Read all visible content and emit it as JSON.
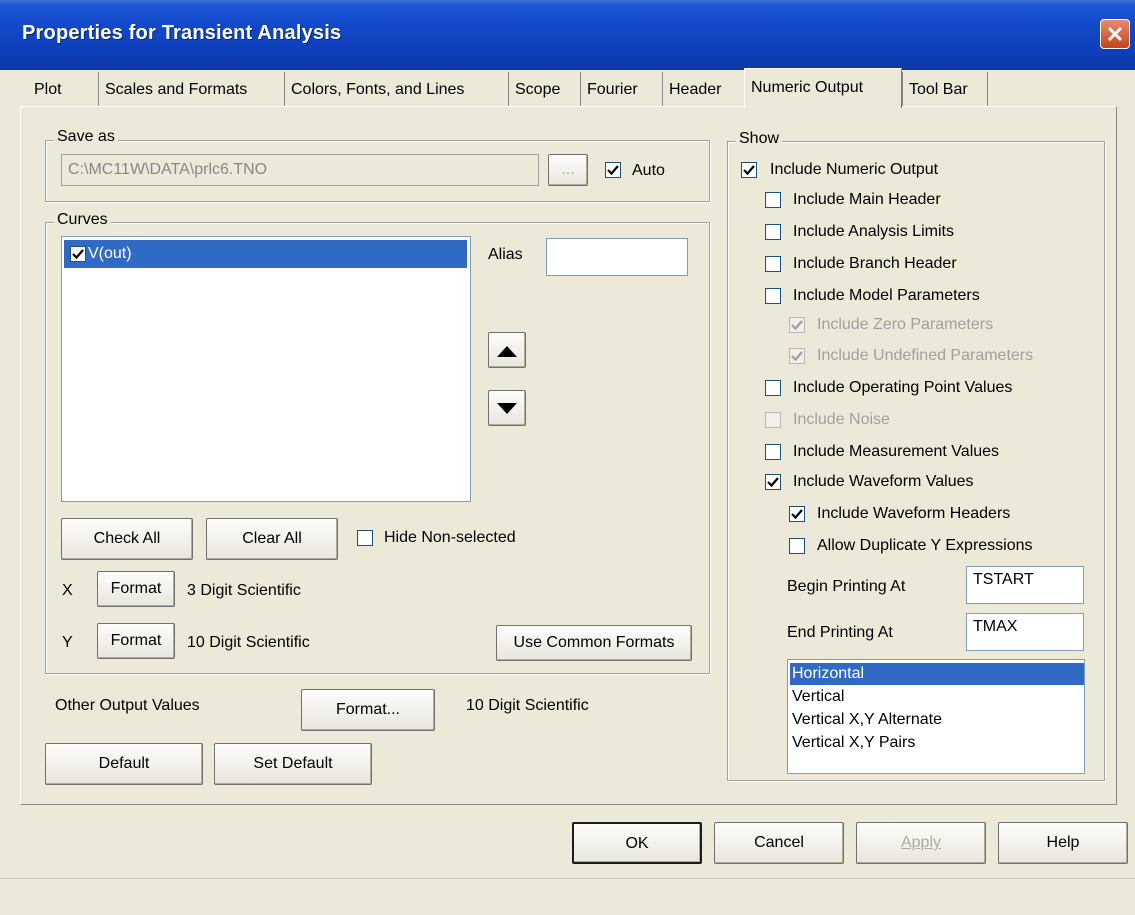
{
  "window": {
    "title": "Properties for Transient Analysis"
  },
  "tabs": [
    {
      "label": "Plot"
    },
    {
      "label": "Scales and Formats"
    },
    {
      "label": "Colors, Fonts, and Lines"
    },
    {
      "label": "Scope"
    },
    {
      "label": "Fourier"
    },
    {
      "label": "Header"
    },
    {
      "label": "Numeric Output"
    },
    {
      "label": "Tool Bar"
    }
  ],
  "save_as": {
    "group_label": "Save as",
    "path": "C:\\MC11W\\DATA\\prlc6.TNO",
    "browse_label": "...",
    "auto_label": "Auto",
    "auto_checked": true
  },
  "curves": {
    "group_label": "Curves",
    "items": [
      {
        "label": "V(out)",
        "checked": true
      }
    ],
    "alias_label": "Alias",
    "alias_value": "",
    "check_all": "Check All",
    "clear_all": "Clear All",
    "hide_non_selected": "Hide Non-selected",
    "x_label": "X",
    "y_label": "Y",
    "format_label": "Format",
    "x_format": "3 Digit Scientific",
    "y_format": "10 Digit Scientific",
    "use_common_formats": "Use Common Formats"
  },
  "other_output": {
    "label": "Other Output Values",
    "button": "Format...",
    "value": "10 Digit Scientific"
  },
  "defaults": {
    "default": "Default",
    "set_default": "Set Default"
  },
  "show": {
    "group_label": "Show",
    "options": [
      {
        "label": "Include Numeric Output",
        "checked": true,
        "enabled": true
      },
      {
        "label": "Include Main Header",
        "checked": false,
        "enabled": true
      },
      {
        "label": "Include Analysis Limits",
        "checked": false,
        "enabled": true
      },
      {
        "label": "Include Branch Header",
        "checked": false,
        "enabled": true
      },
      {
        "label": "Include Model Parameters",
        "checked": false,
        "enabled": true
      },
      {
        "label": "Include Zero Parameters",
        "checked": true,
        "enabled": false
      },
      {
        "label": "Include Undefined Parameters",
        "checked": true,
        "enabled": false
      },
      {
        "label": "Include Operating Point Values",
        "checked": false,
        "enabled": true
      },
      {
        "label": "Include Noise",
        "checked": false,
        "enabled": false
      },
      {
        "label": "Include Measurement Values",
        "checked": false,
        "enabled": true
      },
      {
        "label": "Include Waveform Values",
        "checked": true,
        "enabled": true
      },
      {
        "label": "Include Waveform Headers",
        "checked": true,
        "enabled": true
      },
      {
        "label": "Allow Duplicate Y Expressions",
        "checked": false,
        "enabled": true
      }
    ],
    "begin_label": "Begin Printing At",
    "begin_value": "TSTART",
    "end_label": "End Printing At",
    "end_value": "TMAX",
    "layouts": [
      "Horizontal",
      "Vertical",
      "Vertical X,Y Alternate",
      "Vertical X,Y Pairs"
    ],
    "selected_layout": "Horizontal"
  },
  "buttons": {
    "ok": "OK",
    "cancel": "Cancel",
    "apply": "Apply",
    "help": "Help"
  },
  "colors": {
    "title_bar": "#1247c9",
    "selection": "#316ac5",
    "dialog_bg": "#ece9d8",
    "close": "#c6421a"
  }
}
